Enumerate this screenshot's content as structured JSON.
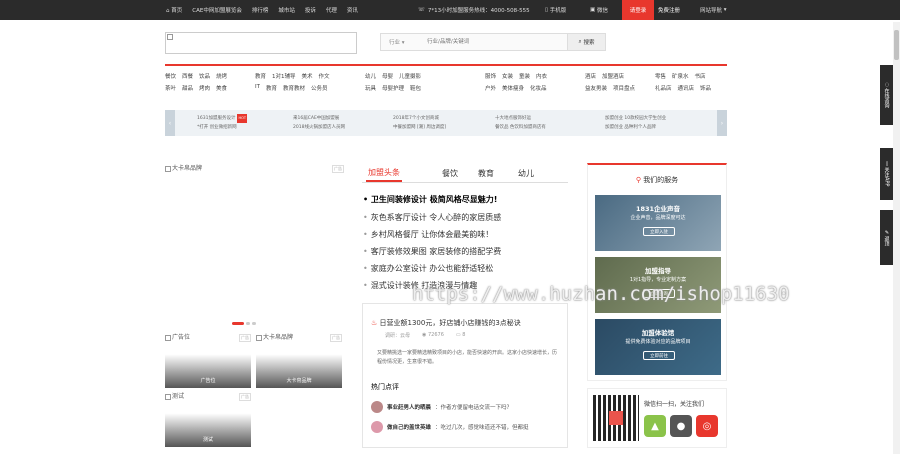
{
  "topbar": {
    "nav": [
      "首页",
      "CAE中网加盟展览会",
      "排行榜",
      "城市站",
      "投诉",
      "代理",
      "资讯"
    ],
    "phone": "7*13小时加盟服务热线：4000-508-555",
    "mobile": "手机版",
    "wechat": "微信",
    "login": "请登录",
    "register": "免费注册",
    "site_nav": "网站导航"
  },
  "search": {
    "select": "行业",
    "placeholder": "行业/品牌/关键词",
    "button": "搜索"
  },
  "categories": {
    "row1": [
      [
        "餐饮",
        "西餐",
        "饮品",
        "烧烤"
      ],
      [
        "教育",
        "1对1辅导",
        "美术",
        "作文"
      ],
      [
        "幼儿",
        "母婴",
        "儿童摄影"
      ],
      [
        "服饰",
        "女装",
        "童装",
        "内衣"
      ],
      [
        "酒店",
        "加盟酒店"
      ],
      [
        "零售",
        "矿泉水",
        "书店"
      ]
    ],
    "row2": [
      [
        "茶叶",
        "甜品",
        "烤肉",
        "美食"
      ],
      [
        "IT",
        "教育",
        "教育教材",
        "公务员"
      ],
      [
        "玩具",
        "母婴护理",
        "鞋包"
      ],
      [
        "户外",
        "美体瘦身",
        "化妆品"
      ],
      [
        "益友男装",
        "项目盘点"
      ],
      [
        "礼品店",
        "通讯店",
        "饰品"
      ]
    ]
  },
  "ticker": [
    [
      "1631加盟服务设计",
      "*打开 创业微招新网"
    ],
    [
      "来16届CAE中国加盟展",
      "2018线火锅加盟店人员网"
    ],
    [
      "2018年7个小文创商城",
      "中餐加盟网 [潮] 周边调度]"
    ],
    [
      "十大地点服饰好运",
      "餐饮品 色饮料加盟商店有"
    ],
    [
      "加盟创业 10款校园大学生创业",
      "加盟创业 品种利个人品牌"
    ]
  ],
  "left_ad": {
    "title": "大卡帛品牌",
    "tag": "广告"
  },
  "thumbs": [
    {
      "img": "广告位",
      "label": "广告位",
      "tag": "广告"
    },
    {
      "img": "大卡帛品牌",
      "label": "大卡帛品牌",
      "tag": "广告"
    },
    {
      "img": "测试",
      "label": "测试",
      "tag": "广告"
    }
  ],
  "tabs": [
    "加盟头条",
    "餐饮",
    "教育",
    "幼儿"
  ],
  "news": {
    "first": "卫生间装修设计 极简风格尽显魅力!",
    "items": [
      "灰色系客厅设计 令人心醉的家居质感",
      "乡村风格餐厅 让你体会最美韵味！",
      "客厅装修效果图 家居装修的搭配学费",
      "家庭办公室设计 办公也能舒适轻松",
      "混式设计装修 打造浪漫与情趣"
    ]
  },
  "card": {
    "title": "日营业额1300元，好店铺小店赚钱的3点秘诀",
    "author": "调研：云母",
    "views": "72676",
    "comments": "8",
    "desc": "又要精挑选一家要精选精致项目的小店，能否快速的开启。这家小店快速增长，历程份情况更，生意很不错。",
    "hot_title": "热门点评",
    "comments_list": [
      {
        "name": "事业赶男人的晒晨",
        "text": "作者方便留电话交流一下吗？"
      },
      {
        "name": "做自己的盖世英雄",
        "text": "吃过几次，感觉味道还不错，但都挺"
      }
    ]
  },
  "services": {
    "heading": "我们的服务",
    "boxes": [
      {
        "t1": "1831企业声音",
        "t2": "企业声音，品牌深度可达",
        "btn": "立即入驻"
      },
      {
        "t1": "加盟指导",
        "t2": "1对1指导，专业定制方案",
        "btn": "立即咨询"
      },
      {
        "t1": "加盟体验馆",
        "t2": "提供免费体验对应的品牌项目",
        "btn": "立即前往"
      }
    ]
  },
  "qr": {
    "text": "微信扫一扫，关注我们"
  },
  "side": [
    "在线咨询",
    "关注APP",
    "返顶"
  ],
  "watermark": "https://www.huzhan.com/ishop11630",
  "colors": {
    "accent": "#e8372d",
    "topbar": "#2b2b2b"
  }
}
